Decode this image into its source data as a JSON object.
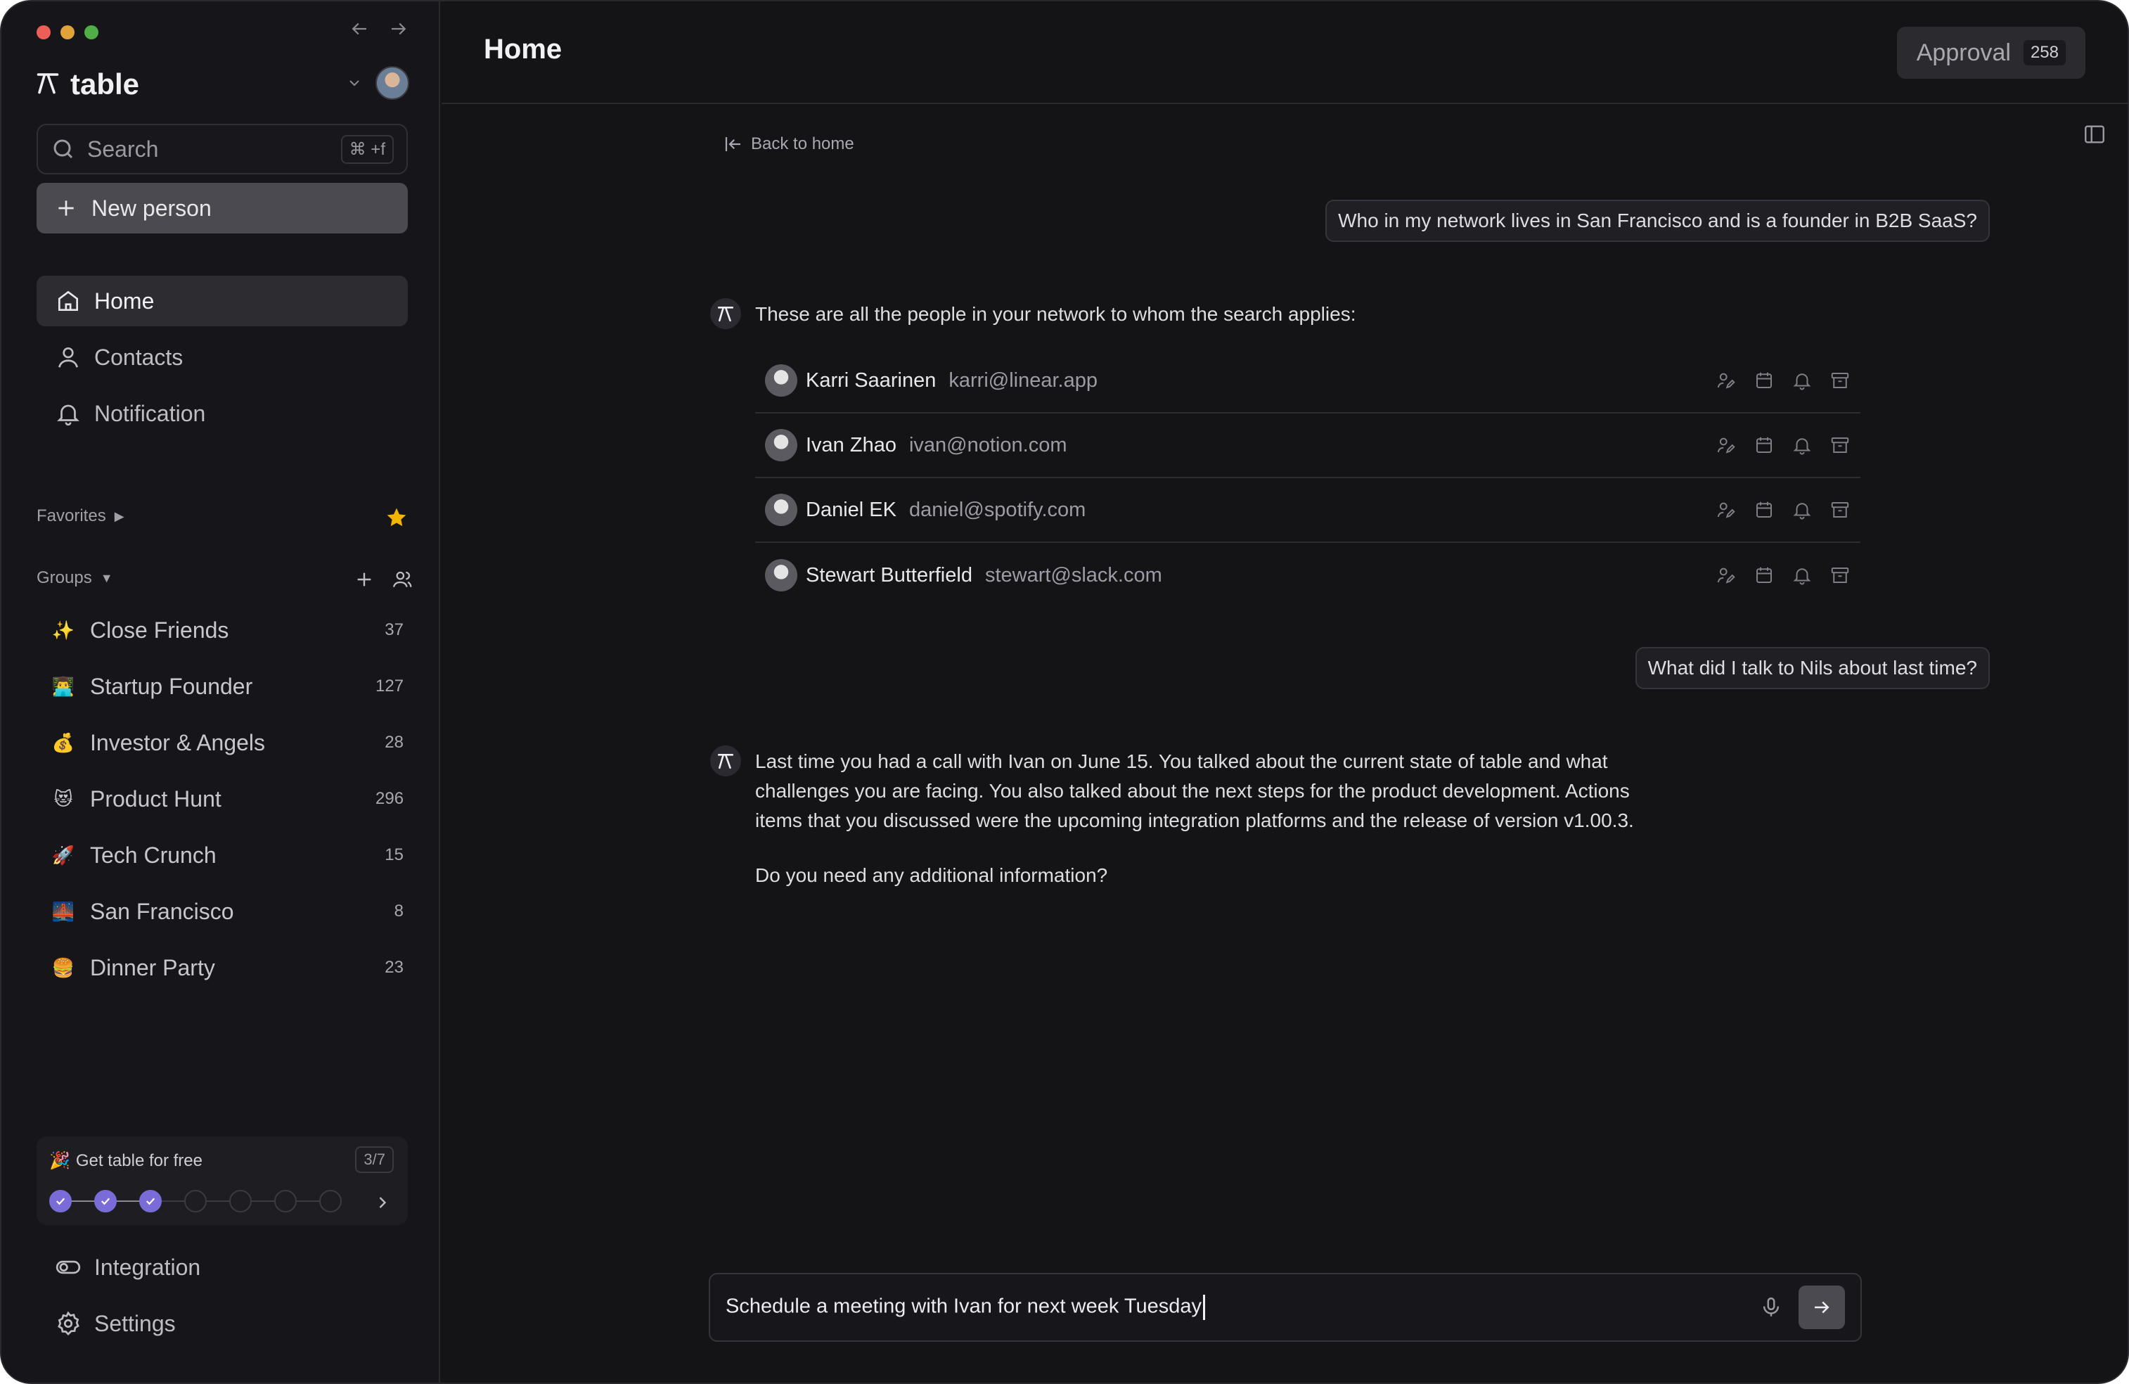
{
  "sidebar": {
    "brand": "table",
    "search": {
      "placeholder": "Search",
      "shortcut": "⌘ +f"
    },
    "new_person": "New person",
    "nav": [
      {
        "label": "Home",
        "icon": "home-icon",
        "active": true
      },
      {
        "label": "Contacts",
        "icon": "user-icon"
      },
      {
        "label": "Notification",
        "icon": "bell-icon"
      }
    ],
    "favorites_label": "Favorites",
    "groups_label": "Groups",
    "groups": [
      {
        "emoji": "✨",
        "label": "Close Friends",
        "count": "37"
      },
      {
        "emoji": "👨‍💻",
        "label": "Startup Founder",
        "count": "127"
      },
      {
        "emoji": "💰",
        "label": "Investor & Angels",
        "count": "28"
      },
      {
        "emoji": "😻",
        "label": "Product Hunt",
        "count": "296"
      },
      {
        "emoji": "🚀",
        "label": "Tech Crunch",
        "count": "15"
      },
      {
        "emoji": "🌉",
        "label": "San Francisco",
        "count": "8"
      },
      {
        "emoji": "🍔",
        "label": "Dinner Party",
        "count": "23"
      }
    ],
    "promo": {
      "emoji": "🎉",
      "title": "Get table for free",
      "progress": "3/7",
      "completed": 3,
      "total": 7
    },
    "bottom_nav": [
      {
        "label": "Integration",
        "icon": "toggle-icon"
      },
      {
        "label": "Settings",
        "icon": "gear-icon"
      }
    ]
  },
  "header": {
    "title": "Home",
    "approval_label": "Approval",
    "approval_count": "258"
  },
  "chat": {
    "back_label": "Back to home",
    "q1": "Who in my network lives in San Francisco and is a founder in B2B SaaS?",
    "a1": "These are all the people in your network to whom the search applies:",
    "people": [
      {
        "name": "Karri Saarinen",
        "email": "karri@linear.app"
      },
      {
        "name": "Ivan Zhao",
        "email": "ivan@notion.com"
      },
      {
        "name": "Daniel EK",
        "email": "daniel@spotify.com"
      },
      {
        "name": "Stewart Butterfield",
        "email": "stewart@slack.com"
      }
    ],
    "q2": "What did I talk to Nils about last time?",
    "a2_line1": "Last time you had a call with Ivan on June 15. You talked about the current state of table and what",
    "a2_line2": "challenges you are facing. You also talked about the next steps for the product development. Actions",
    "a2_line3": "items that you discussed were the upcoming integration platforms and the release of version v1.00.3.",
    "a2_followup": "Do you need any additional information?"
  },
  "composer": {
    "value": "Schedule a meeting with Ivan for next week Tuesday"
  },
  "colors": {
    "background": "#141417",
    "sidebar": "#16161a",
    "accent": "#7a6cd8",
    "star": "#f5b400"
  }
}
